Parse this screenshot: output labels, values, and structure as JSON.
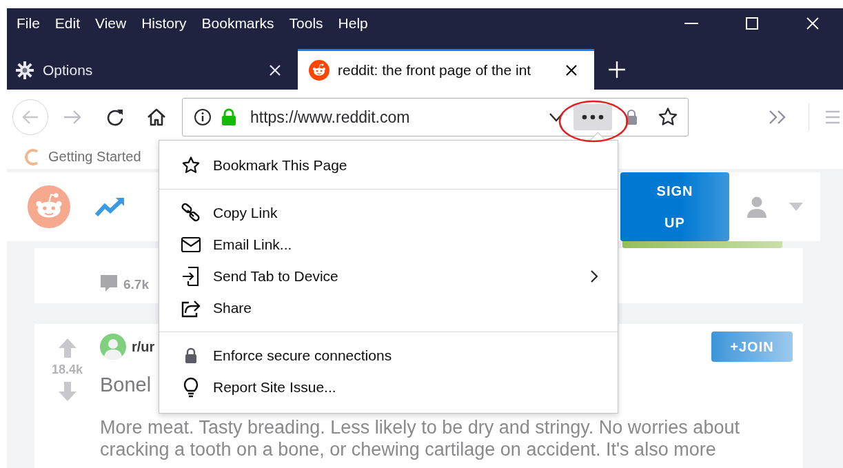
{
  "menu_bar": [
    "File",
    "Edit",
    "View",
    "History",
    "Bookmarks",
    "Tools",
    "Help"
  ],
  "tabs": [
    {
      "label": "Options",
      "kind": "settings",
      "selected": false
    },
    {
      "label": "reddit: the front page of the int",
      "kind": "site",
      "selected": true
    }
  ],
  "address_bar": {
    "url": "https://www.reddit.com",
    "page_actions_open": true
  },
  "bookmarks_toolbar": [
    {
      "label": "Getting Started"
    }
  ],
  "page_actions_menu": [
    {
      "kind": "item",
      "label": "Bookmark This Page"
    },
    {
      "kind": "separator"
    },
    {
      "kind": "item",
      "label": "Copy Link"
    },
    {
      "kind": "item",
      "label": "Email Link..."
    },
    {
      "kind": "submenu",
      "label": "Send Tab to Device"
    },
    {
      "kind": "item",
      "label": "Share"
    },
    {
      "kind": "separator"
    },
    {
      "kind": "item",
      "label": "Enforce secure connections"
    },
    {
      "kind": "item",
      "label": "Report Site Issue..."
    }
  ],
  "page": {
    "header": {
      "sign_up": "SIGN UP"
    },
    "posts": [
      {
        "comments": "6.7k"
      },
      {
        "votes": "18.4k",
        "subreddit": "r/ur",
        "title": "Bonel",
        "join": "+JOIN",
        "body": "More meat. Tasty breading. Less likely to be dry and stringy. No worries about cracking a tooth on a bone, or chewing cartilage on accident. It's also more"
      }
    ]
  }
}
